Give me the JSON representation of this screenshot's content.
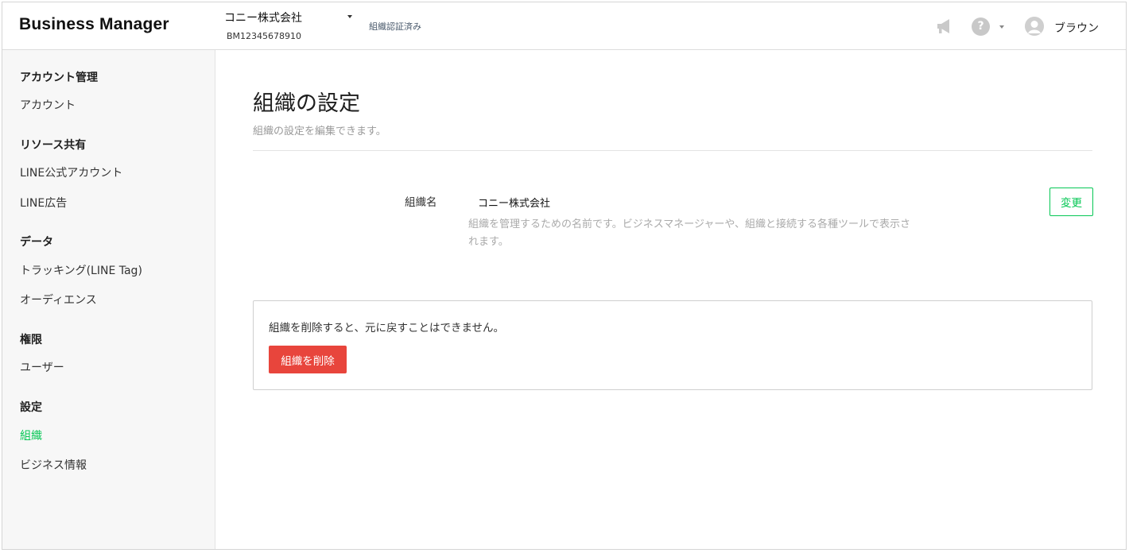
{
  "header": {
    "logo": "Business Manager",
    "org_name": "コニー株式会社",
    "org_id": "BM12345678910",
    "verified_label": "組織認証済み",
    "user_name": "ブラウン",
    "help_glyph": "?",
    "icons": [
      "megaphone-icon",
      "help-icon",
      "chevron-down-icon",
      "avatar-icon"
    ]
  },
  "sidebar": {
    "groups": [
      {
        "title": "アカウント管理",
        "items": [
          "アカウント"
        ]
      },
      {
        "title": "リソース共有",
        "items": [
          "LINE公式アカウント",
          "LINE広告"
        ]
      },
      {
        "title": "データ",
        "items": [
          "トラッキング(LINE Tag)",
          "オーディエンス"
        ]
      },
      {
        "title": "権限",
        "items": [
          "ユーザー"
        ]
      },
      {
        "title": "設定",
        "items": [
          "組織",
          "ビジネス情報"
        ]
      }
    ],
    "active_item": "組織"
  },
  "main": {
    "title": "組織の設定",
    "subtitle": "組織の設定を編集できます。",
    "org_field": {
      "label": "組織名",
      "value": "コニー株式会社",
      "help": "組織を管理するための名前です。ビジネスマネージャーや、組織と接続する各種ツールで表示されます。",
      "change_label": "変更"
    },
    "danger": {
      "message": "組織を削除すると、元に戻すことはできません。",
      "delete_label": "組織を削除"
    }
  },
  "colors": {
    "accent": "#06c755",
    "danger": "#e8453c",
    "sidebar_bg": "#f7f7f7",
    "muted_text": "#9a9a9a"
  }
}
